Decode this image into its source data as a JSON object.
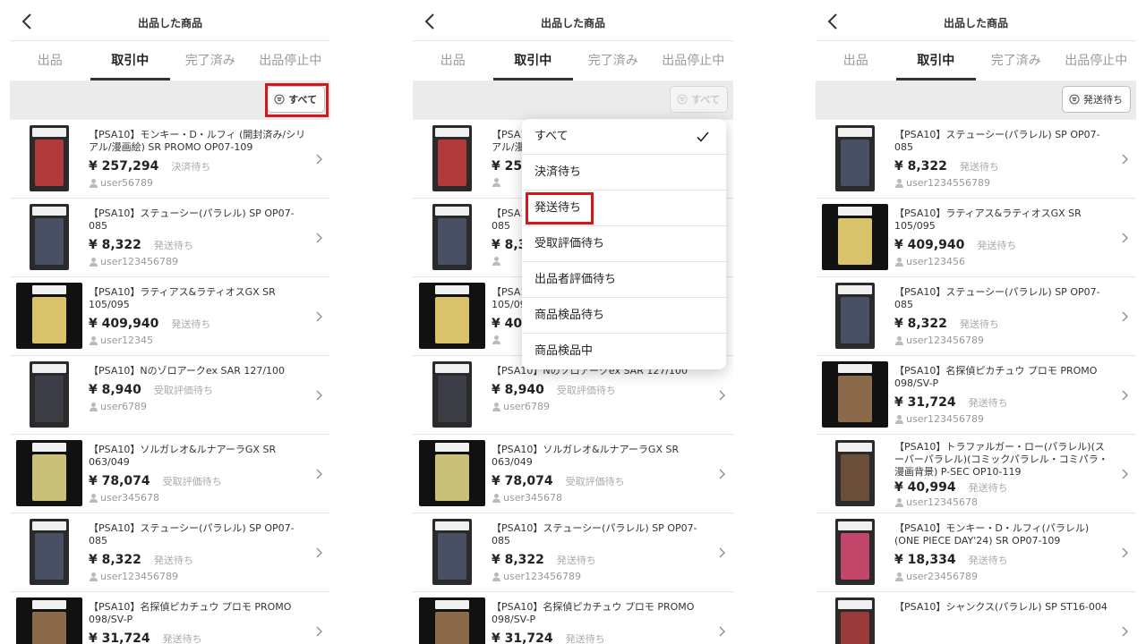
{
  "header": {
    "title": "出品した商品"
  },
  "tabs": [
    "出品",
    "取引中",
    "完了済み",
    "出品停止中"
  ],
  "filter_all_label": "すべて",
  "filter_shipping_label": "発送待ち",
  "dropdown": [
    "すべて",
    "決済待ち",
    "発送待ち",
    "受取評価待ち",
    "出品者評価待ち",
    "商品検品待ち",
    "商品検品中"
  ],
  "colors": {
    "highlight": "#d0191d",
    "active_tab": "#333333"
  },
  "panel1": [
    {
      "name": "【PSA10】モンキー・D・ルフィ (開封済み/シリアル/漫画絵) SR PROMO OP07-109",
      "price": "¥ 257,294",
      "status": "決済待ち",
      "user": "user56789"
    },
    {
      "name": "【PSA10】ステューシー(パラレル) SP OP07-085",
      "price": "¥ 8,322",
      "status": "発送待ち",
      "user": "user123456789"
    },
    {
      "name": "【PSA10】ラティアス&ラティオスGX SR 105/095",
      "price": "¥ 409,940",
      "status": "発送待ち",
      "user": "user12345"
    },
    {
      "name": "【PSA10】Nのゾロアークex SAR 127/100",
      "price": "¥ 8,940",
      "status": "受取評価待ち",
      "user": "user6789"
    },
    {
      "name": "【PSA10】ソルガレオ&ルナアーラGX SR 063/049",
      "price": "¥ 78,074",
      "status": "受取評価待ち",
      "user": "user345678"
    },
    {
      "name": "【PSA10】ステューシー(パラレル) SP OP07-085",
      "price": "¥ 8,322",
      "status": "発送待ち",
      "user": "user123456789"
    },
    {
      "name": "【PSA10】名探偵ピカチュウ プロモ PROMO 098/SV-P",
      "price": "¥ 31,724",
      "status": "発送待ち",
      "user": ""
    }
  ],
  "panel3": [
    {
      "name": "【PSA10】ステューシー(パラレル) SP OP07-085",
      "price": "¥ 8,322",
      "status": "発送待ち",
      "user": "user1234556789"
    },
    {
      "name": "【PSA10】ラティアス&ラティオスGX SR 105/095",
      "price": "¥ 409,940",
      "status": "発送待ち",
      "user": "user123456"
    },
    {
      "name": "【PSA10】ステューシー(パラレル) SP OP07-085",
      "price": "¥ 8,322",
      "status": "発送待ち",
      "user": "user123456789"
    },
    {
      "name": "【PSA10】名探偵ピカチュウ プロモ PROMO 098/SV-P",
      "price": "¥ 31,724",
      "status": "発送待ち",
      "user": "user123456789"
    },
    {
      "name": "【PSA10】トラファルガー・ロー(パラレル)(スーパーパラレル)(コミックパラレル・コミパラ・漫画背景) P-SEC OP10-119",
      "price": "¥ 40,994",
      "status": "発送待ち",
      "user": "user12345678"
    },
    {
      "name": "【PSA10】モンキー・D・ルフィ(パラレル)(ONE PIECE DAY'24) SR OP07-109",
      "price": "¥ 18,334",
      "status": "発送待ち",
      "user": "user23456789"
    },
    {
      "name": "【PSA10】シャンクス(パラレル) SP ST16-004",
      "price": "",
      "status": "",
      "user": ""
    }
  ]
}
